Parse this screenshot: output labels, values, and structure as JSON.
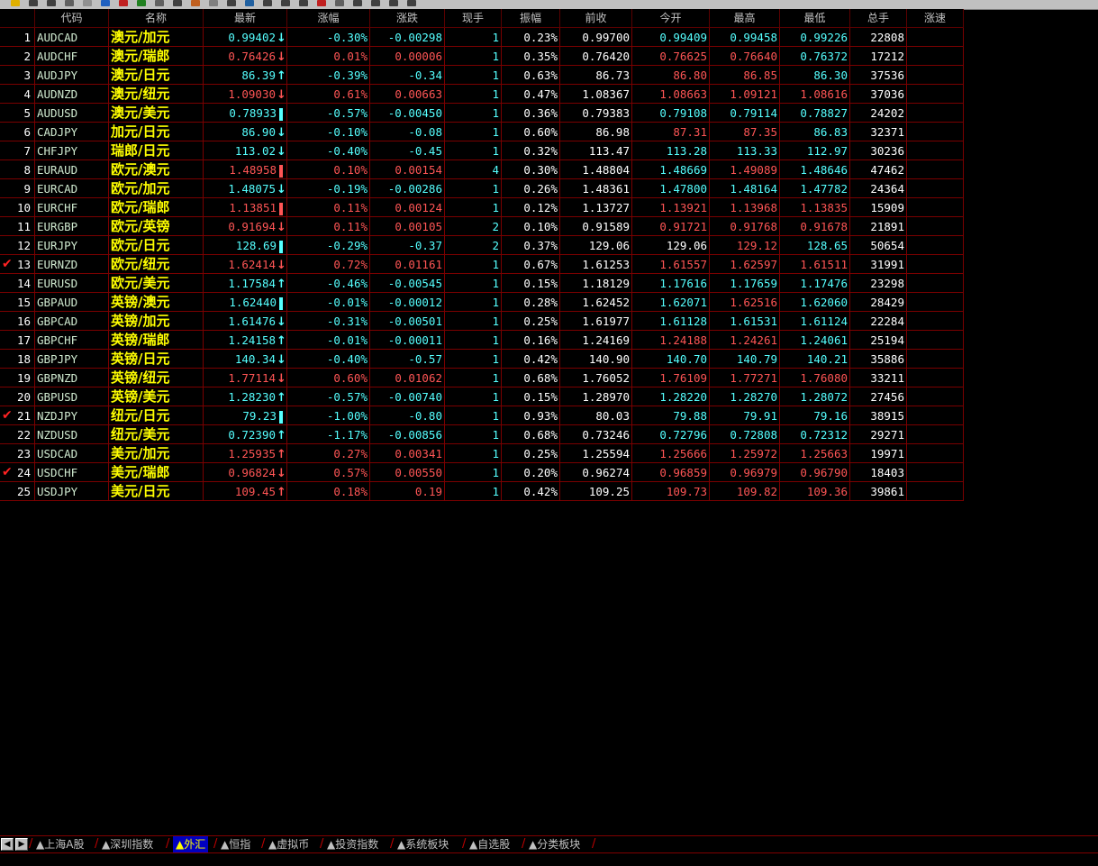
{
  "colors": {
    "up": "#ff5555",
    "down": "#55ffff",
    "flat": "#ffffff",
    "name": "#ffff00",
    "grid": "#7a0000",
    "active_tab": "#0000c0"
  },
  "headers": [
    "",
    "代码",
    "名称",
    "最新",
    "涨幅",
    "涨跌",
    "现手",
    "振幅",
    "前收",
    "今开",
    "最高",
    "最低",
    "总手",
    "涨速"
  ],
  "rows": [
    {
      "idx": "1",
      "code": "AUDCAD",
      "name": "澳元/加元",
      "last": "0.99402",
      "trend": "down",
      "chg_pct": "-0.30%",
      "chg": "-0.00298",
      "vol": "1",
      "amp": "0.23%",
      "prev": "0.99700",
      "open": "0.99409",
      "high": "0.99458",
      "low": "0.99226",
      "total": "22808",
      "checked": false
    },
    {
      "idx": "2",
      "code": "AUDCHF",
      "name": "澳元/瑞郎",
      "last": "0.76426",
      "trend": "down",
      "chg_pct": "0.01%",
      "chg": "0.00006",
      "vol": "1",
      "amp": "0.35%",
      "prev": "0.76420",
      "open": "0.76625",
      "high": "0.76640",
      "low": "0.76372",
      "total": "17212",
      "checked": false
    },
    {
      "idx": "3",
      "code": "AUDJPY",
      "name": "澳元/日元",
      "last": "86.39",
      "trend": "up",
      "chg_pct": "-0.39%",
      "chg": "-0.34",
      "vol": "1",
      "amp": "0.63%",
      "prev": "86.73",
      "open": "86.80",
      "high": "86.85",
      "low": "86.30",
      "total": "37536",
      "checked": false
    },
    {
      "idx": "4",
      "code": "AUDNZD",
      "name": "澳元/纽元",
      "last": "1.09030",
      "trend": "down",
      "chg_pct": "0.61%",
      "chg": "0.00663",
      "vol": "1",
      "amp": "0.47%",
      "prev": "1.08367",
      "open": "1.08663",
      "high": "1.09121",
      "low": "1.08616",
      "total": "37036",
      "checked": false
    },
    {
      "idx": "5",
      "code": "AUDUSD",
      "name": "澳元/美元",
      "last": "0.78933",
      "trend": "bar",
      "chg_pct": "-0.57%",
      "chg": "-0.00450",
      "vol": "1",
      "amp": "0.36%",
      "prev": "0.79383",
      "open": "0.79108",
      "high": "0.79114",
      "low": "0.78827",
      "total": "24202",
      "checked": false
    },
    {
      "idx": "6",
      "code": "CADJPY",
      "name": "加元/日元",
      "last": "86.90",
      "trend": "down",
      "chg_pct": "-0.10%",
      "chg": "-0.08",
      "vol": "1",
      "amp": "0.60%",
      "prev": "86.98",
      "open": "87.31",
      "high": "87.35",
      "low": "86.83",
      "total": "32371",
      "checked": false
    },
    {
      "idx": "7",
      "code": "CHFJPY",
      "name": "瑞郎/日元",
      "last": "113.02",
      "trend": "down",
      "chg_pct": "-0.40%",
      "chg": "-0.45",
      "vol": "1",
      "amp": "0.32%",
      "prev": "113.47",
      "open": "113.28",
      "high": "113.33",
      "low": "112.97",
      "total": "30236",
      "checked": false
    },
    {
      "idx": "8",
      "code": "EURAUD",
      "name": "欧元/澳元",
      "last": "1.48958",
      "trend": "bar",
      "chg_pct": "0.10%",
      "chg": "0.00154",
      "vol": "4",
      "amp": "0.30%",
      "prev": "1.48804",
      "open": "1.48669",
      "high": "1.49089",
      "low": "1.48646",
      "total": "47462",
      "checked": false
    },
    {
      "idx": "9",
      "code": "EURCAD",
      "name": "欧元/加元",
      "last": "1.48075",
      "trend": "down",
      "chg_pct": "-0.19%",
      "chg": "-0.00286",
      "vol": "1",
      "amp": "0.26%",
      "prev": "1.48361",
      "open": "1.47800",
      "high": "1.48164",
      "low": "1.47782",
      "total": "24364",
      "checked": false
    },
    {
      "idx": "10",
      "code": "EURCHF",
      "name": "欧元/瑞郎",
      "last": "1.13851",
      "trend": "bar",
      "chg_pct": "0.11%",
      "chg": "0.00124",
      "vol": "1",
      "amp": "0.12%",
      "prev": "1.13727",
      "open": "1.13921",
      "high": "1.13968",
      "low": "1.13835",
      "total": "15909",
      "checked": false
    },
    {
      "idx": "11",
      "code": "EURGBP",
      "name": "欧元/英镑",
      "last": "0.91694",
      "trend": "down",
      "chg_pct": "0.11%",
      "chg": "0.00105",
      "vol": "2",
      "amp": "0.10%",
      "prev": "0.91589",
      "open": "0.91721",
      "high": "0.91768",
      "low": "0.91678",
      "total": "21891",
      "checked": false
    },
    {
      "idx": "12",
      "code": "EURJPY",
      "name": "欧元/日元",
      "last": "128.69",
      "trend": "bar",
      "chg_pct": "-0.29%",
      "chg": "-0.37",
      "vol": "2",
      "amp": "0.37%",
      "prev": "129.06",
      "open": "129.06",
      "high": "129.12",
      "low": "128.65",
      "total": "50654",
      "checked": false
    },
    {
      "idx": "13",
      "code": "EURNZD",
      "name": "欧元/纽元",
      "last": "1.62414",
      "trend": "down",
      "chg_pct": "0.72%",
      "chg": "0.01161",
      "vol": "1",
      "amp": "0.67%",
      "prev": "1.61253",
      "open": "1.61557",
      "high": "1.62597",
      "low": "1.61511",
      "total": "31991",
      "checked": true
    },
    {
      "idx": "14",
      "code": "EURUSD",
      "name": "欧元/美元",
      "last": "1.17584",
      "trend": "up",
      "chg_pct": "-0.46%",
      "chg": "-0.00545",
      "vol": "1",
      "amp": "0.15%",
      "prev": "1.18129",
      "open": "1.17616",
      "high": "1.17659",
      "low": "1.17476",
      "total": "23298",
      "checked": false
    },
    {
      "idx": "15",
      "code": "GBPAUD",
      "name": "英镑/澳元",
      "last": "1.62440",
      "trend": "bar",
      "chg_pct": "-0.01%",
      "chg": "-0.00012",
      "vol": "1",
      "amp": "0.28%",
      "prev": "1.62452",
      "open": "1.62071",
      "high": "1.62516",
      "low": "1.62060",
      "total": "28429",
      "checked": false
    },
    {
      "idx": "16",
      "code": "GBPCAD",
      "name": "英镑/加元",
      "last": "1.61476",
      "trend": "down",
      "chg_pct": "-0.31%",
      "chg": "-0.00501",
      "vol": "1",
      "amp": "0.25%",
      "prev": "1.61977",
      "open": "1.61128",
      "high": "1.61531",
      "low": "1.61124",
      "total": "22284",
      "checked": false
    },
    {
      "idx": "17",
      "code": "GBPCHF",
      "name": "英镑/瑞郎",
      "last": "1.24158",
      "trend": "up",
      "chg_pct": "-0.01%",
      "chg": "-0.00011",
      "vol": "1",
      "amp": "0.16%",
      "prev": "1.24169",
      "open": "1.24188",
      "high": "1.24261",
      "low": "1.24061",
      "total": "25194",
      "checked": false
    },
    {
      "idx": "18",
      "code": "GBPJPY",
      "name": "英镑/日元",
      "last": "140.34",
      "trend": "down",
      "chg_pct": "-0.40%",
      "chg": "-0.57",
      "vol": "1",
      "amp": "0.42%",
      "prev": "140.90",
      "open": "140.70",
      "high": "140.79",
      "low": "140.21",
      "total": "35886",
      "checked": false
    },
    {
      "idx": "19",
      "code": "GBPNZD",
      "name": "英镑/纽元",
      "last": "1.77114",
      "trend": "down",
      "chg_pct": "0.60%",
      "chg": "0.01062",
      "vol": "1",
      "amp": "0.68%",
      "prev": "1.76052",
      "open": "1.76109",
      "high": "1.77271",
      "low": "1.76080",
      "total": "33211",
      "checked": false
    },
    {
      "idx": "20",
      "code": "GBPUSD",
      "name": "英镑/美元",
      "last": "1.28230",
      "trend": "up",
      "chg_pct": "-0.57%",
      "chg": "-0.00740",
      "vol": "1",
      "amp": "0.15%",
      "prev": "1.28970",
      "open": "1.28220",
      "high": "1.28270",
      "low": "1.28072",
      "total": "27456",
      "checked": false
    },
    {
      "idx": "21",
      "code": "NZDJPY",
      "name": "纽元/日元",
      "last": "79.23",
      "trend": "bar",
      "chg_pct": "-1.00%",
      "chg": "-0.80",
      "vol": "1",
      "amp": "0.93%",
      "prev": "80.03",
      "open": "79.88",
      "high": "79.91",
      "low": "79.16",
      "total": "38915",
      "checked": true
    },
    {
      "idx": "22",
      "code": "NZDUSD",
      "name": "纽元/美元",
      "last": "0.72390",
      "trend": "up",
      "chg_pct": "-1.17%",
      "chg": "-0.00856",
      "vol": "1",
      "amp": "0.68%",
      "prev": "0.73246",
      "open": "0.72796",
      "high": "0.72808",
      "low": "0.72312",
      "total": "29271",
      "checked": false
    },
    {
      "idx": "23",
      "code": "USDCAD",
      "name": "美元/加元",
      "last": "1.25935",
      "trend": "up",
      "chg_pct": "0.27%",
      "chg": "0.00341",
      "vol": "1",
      "amp": "0.25%",
      "prev": "1.25594",
      "open": "1.25666",
      "high": "1.25972",
      "low": "1.25663",
      "total": "19971",
      "checked": false
    },
    {
      "idx": "24",
      "code": "USDCHF",
      "name": "美元/瑞郎",
      "last": "0.96824",
      "trend": "down",
      "chg_pct": "0.57%",
      "chg": "0.00550",
      "vol": "1",
      "amp": "0.20%",
      "prev": "0.96274",
      "open": "0.96859",
      "high": "0.96979",
      "low": "0.96790",
      "total": "18403",
      "checked": true
    },
    {
      "idx": "25",
      "code": "USDJPY",
      "name": "美元/日元",
      "last": "109.45",
      "trend": "up",
      "chg_pct": "0.18%",
      "chg": "0.19",
      "vol": "1",
      "amp": "0.42%",
      "prev": "109.25",
      "open": "109.73",
      "high": "109.82",
      "low": "109.36",
      "total": "39861",
      "checked": false
    }
  ],
  "tabs": [
    {
      "label": "▲上海A股",
      "active": false
    },
    {
      "label": "▲深圳指数",
      "active": false
    },
    {
      "label": "▲外汇",
      "active": true
    },
    {
      "label": "▲恒指",
      "active": false
    },
    {
      "label": "▲虚拟币",
      "active": false
    },
    {
      "label": "▲投资指数",
      "active": false
    },
    {
      "label": "▲系统板块",
      "active": false
    },
    {
      "label": "▲自选股",
      "active": false
    },
    {
      "label": "▲分类板块",
      "active": false
    }
  ],
  "nav": {
    "prev_label": "◀",
    "next_label": "▶"
  }
}
